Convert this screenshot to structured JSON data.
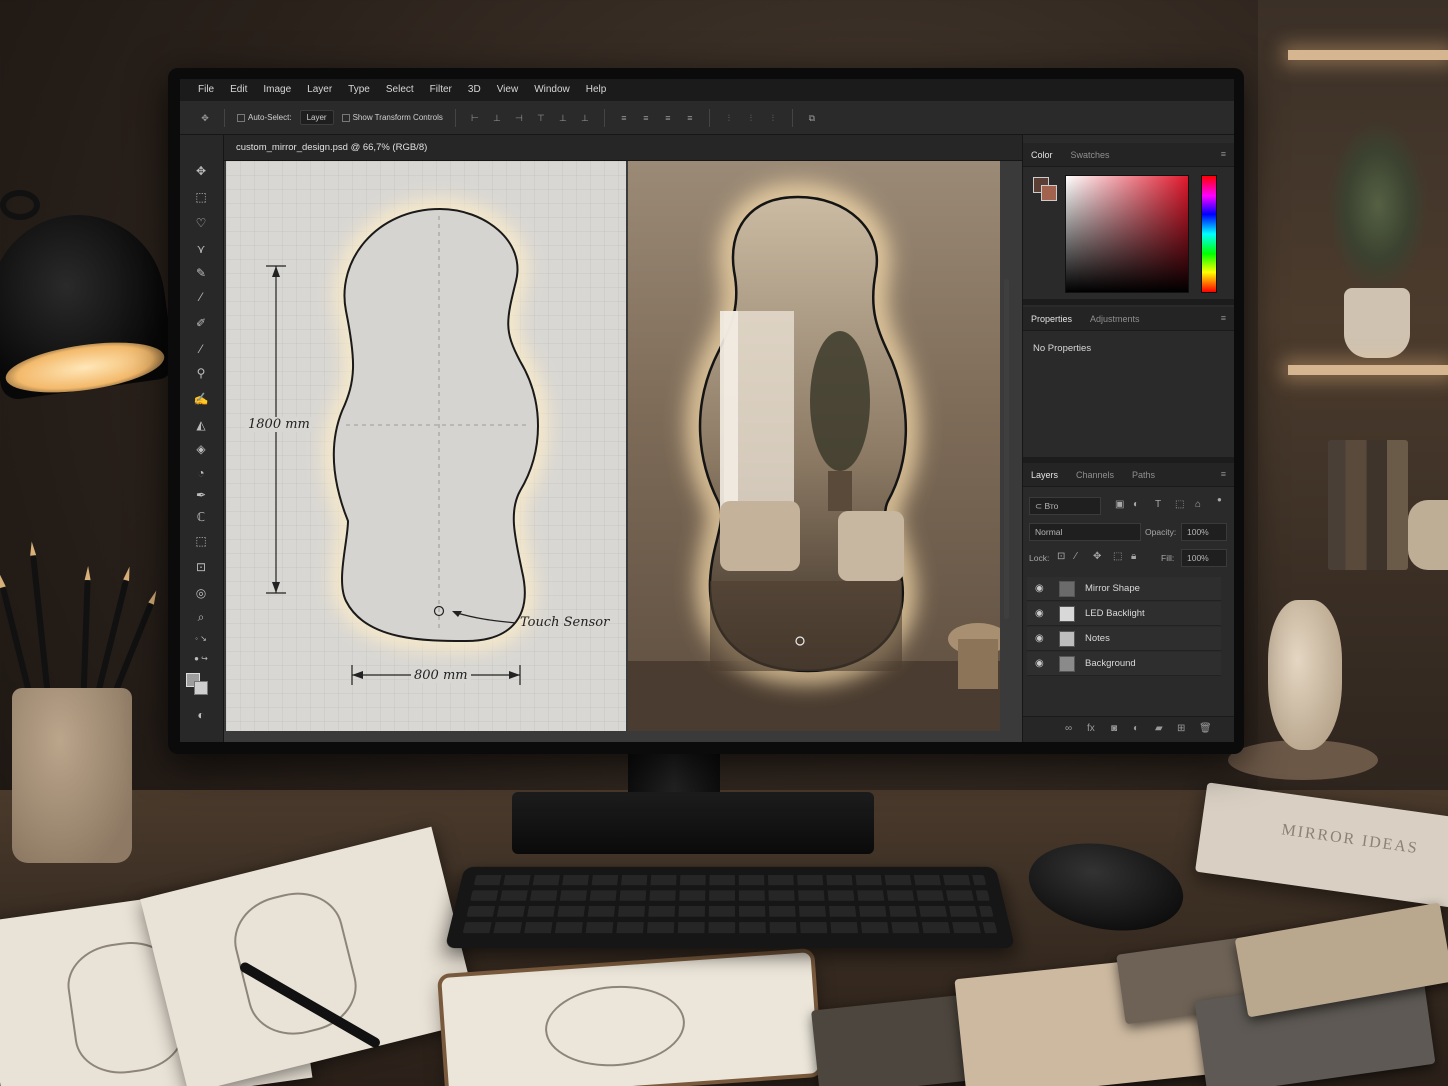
{
  "app": {
    "menu": [
      "File",
      "Edit",
      "Image",
      "Layer",
      "Type",
      "Select",
      "Filter",
      "3D",
      "View",
      "Window",
      "Help"
    ],
    "options_bar": {
      "auto_select_label": "Auto-Select:",
      "auto_select_value": "Layer",
      "show_transform_label": "Show Transform Controls"
    },
    "document_tab": "custom_mirror_design.psd @ 66,7% (RGB/8)",
    "tools": [
      "move-tool-icon",
      "marquee-tool-icon",
      "lasso-tool-icon",
      "polygon-lasso-icon",
      "quick-select-icon",
      "eyedropper-icon",
      "healing-brush-icon",
      "brush-tool-icon",
      "clone-stamp-icon",
      "history-brush-icon",
      "eraser-icon",
      "gradient-icon",
      "blur-icon",
      "dodge-icon",
      "pen-tool-icon",
      "type-tool-icon",
      "path-select-icon",
      "shape-tool-icon",
      "hand-tool-icon",
      "zoom-tool-icon"
    ]
  },
  "canvas": {
    "height_label": "1800 mm",
    "width_label": "800 mm",
    "sensor_label": "Touch Sensor"
  },
  "panels": {
    "color_tabs": [
      "Color",
      "Swatches"
    ],
    "properties_tabs": [
      "Properties",
      "Adjustments"
    ],
    "properties_text": "No Properties",
    "layers_tabs": [
      "Layers",
      "Channels",
      "Paths"
    ],
    "filter_kind": "Вто",
    "blend_mode": "Normal",
    "opacity_label": "Opacity:",
    "opacity_value": "100%",
    "lock_label": "Lock:",
    "fill_label": "Fill:",
    "fill_value": "100%",
    "layers": [
      {
        "name": "Mirror Shape",
        "visible": true
      },
      {
        "name": "LED Backlight",
        "visible": true
      },
      {
        "name": "Notes",
        "visible": true
      },
      {
        "name": "Background",
        "visible": true
      }
    ]
  },
  "scene": {
    "book_title": "MIRROR IDEAS"
  },
  "colors": {
    "foreground": "#5b3f34",
    "background": "#a1624e",
    "led_glow": "#ffe3b0"
  }
}
